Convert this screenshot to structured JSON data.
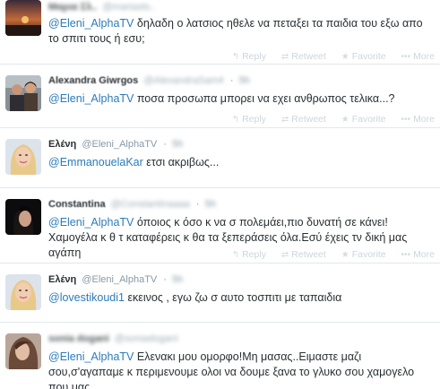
{
  "actions": {
    "reply": "Reply",
    "retweet": "Retweet",
    "favorite": "Favorite",
    "more": "More"
  },
  "tweets": [
    {
      "fullname": "Μαρια Σλ..",
      "username": "@mariaslo..",
      "time": "5h",
      "mention": "@Eleni_AlphaTV",
      "text": " δηλαδη ο λατσιος ηθελε να πεταξει τα παιδια του εξω απο το σπιτι τους ή εσυ;"
    },
    {
      "fullname": "Alexandra Giwrgos",
      "username": "@AlexandraSam4",
      "time": "5h",
      "mention": "@Eleni_AlphaTV",
      "text": " ποσα προσωπα μπορει να εχει ανθρωπος τελικα...?"
    },
    {
      "fullname": "Ελένη",
      "username": "@Eleni_AlphaTV",
      "time": "5h",
      "mention": "@EmmanouelaKar",
      "text": " ετσι ακριβως..."
    },
    {
      "fullname": "Constantina",
      "username": "@Constantinaaaa",
      "time": "5h",
      "mention": "@Eleni_AlphaTV",
      "text": " όποιος κ όσο κ να σ πολεμάει,πιο δυνατή σε κάνει!Χαμογέλα κ θ τ καταφέρεις κ θα τα ξεπεράσεις όλα.Εσύ έχεις τν δική μας αγάπη"
    },
    {
      "fullname": "Ελένη",
      "username": "@Eleni_AlphaTV",
      "time": "5h",
      "mention": "@lovestikoudi1",
      "text": " εκεινος , εγω ζω σ αυτο τοσπιτι με ταπαιδια"
    },
    {
      "fullname": "sonia doganì",
      "username": "@soniadoganì",
      "time": "5h",
      "mention": "@Eleni_AlphaTV",
      "text": " Ελενακι μου ομορφο!Μη μασας..Ειμαστε μαζι σου,σ'αγαπαμε κ περιμενουμε ολοι να δουμε ξανα το γλυκο σου χαμογελο που μας"
    }
  ]
}
